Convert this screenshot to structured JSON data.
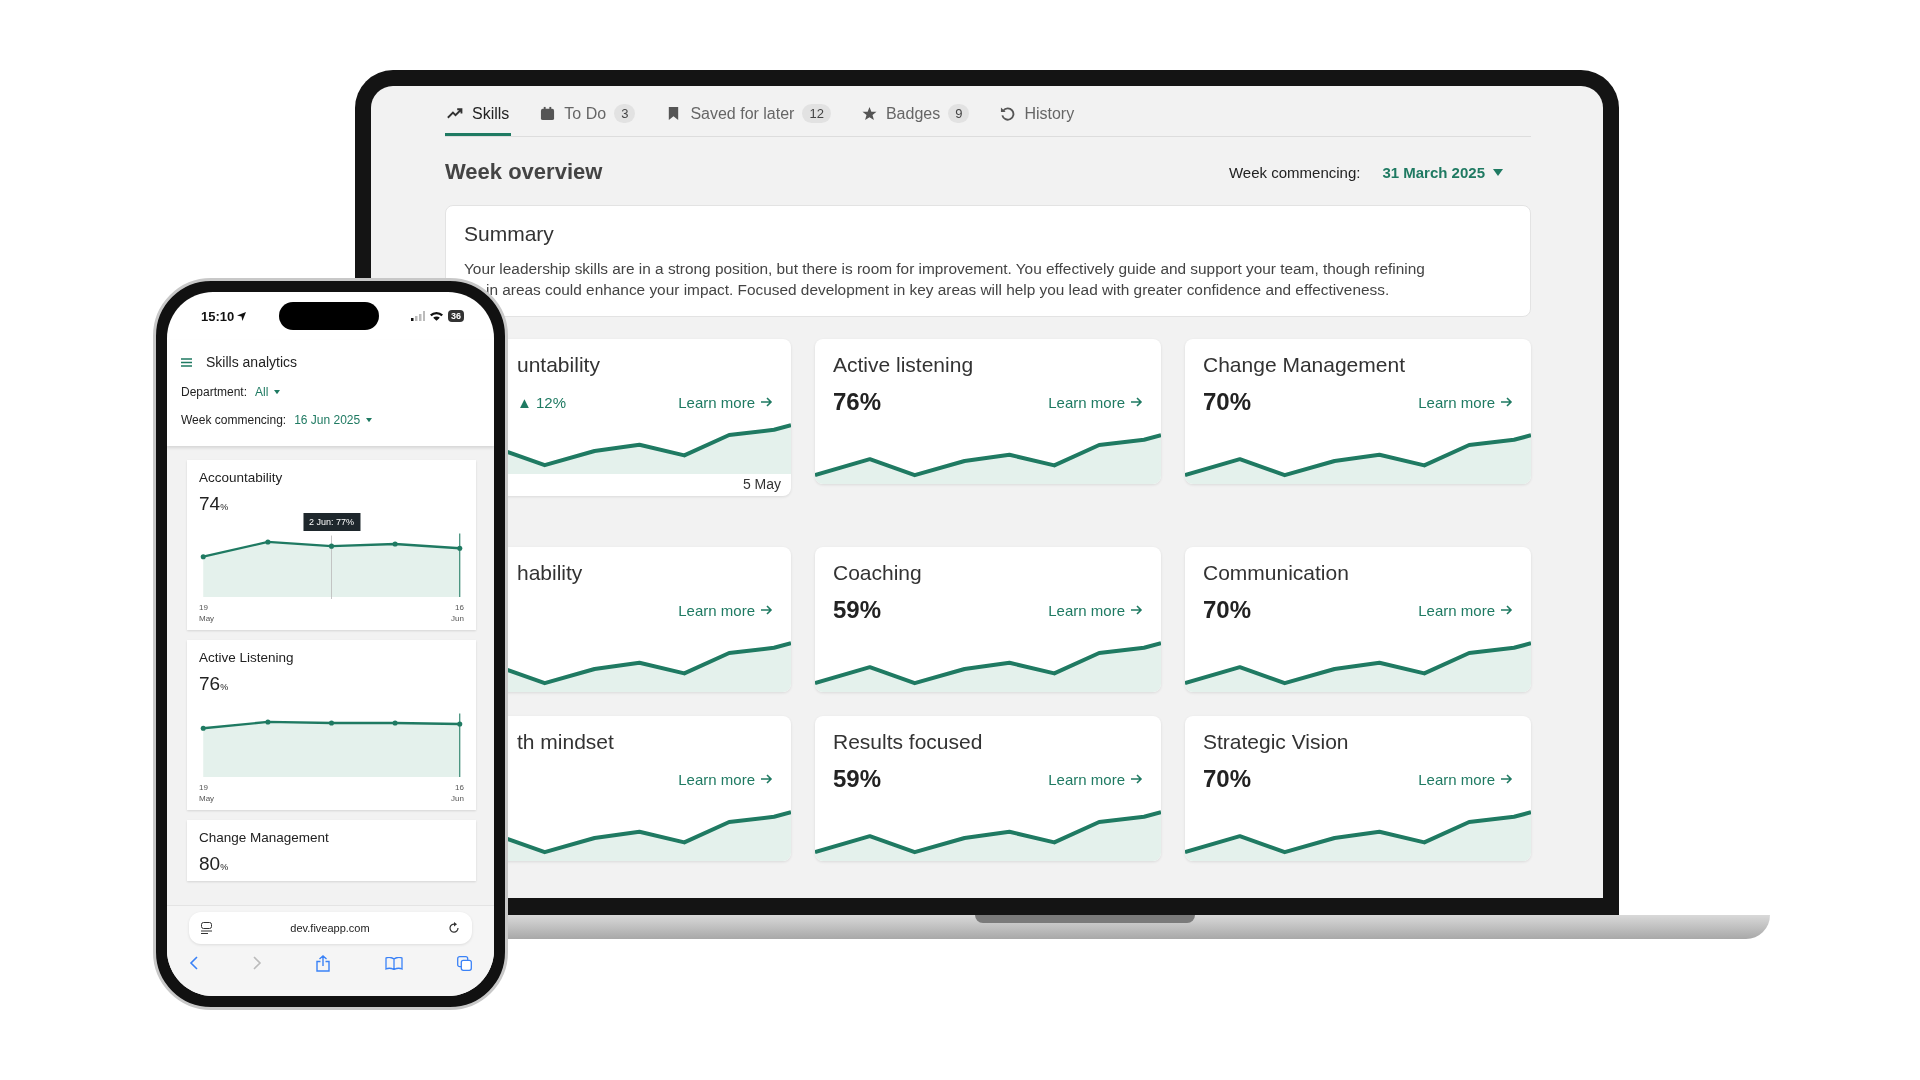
{
  "laptop": {
    "tabs": [
      {
        "label": "Skills",
        "kind": "trend",
        "selected": true
      },
      {
        "label": "To Do",
        "kind": "calendar",
        "count": "3",
        "selected": false
      },
      {
        "label": "Saved for later",
        "kind": "bookmark",
        "count": "12",
        "selected": false
      },
      {
        "label": "Badges",
        "kind": "star",
        "count": "9",
        "selected": false
      },
      {
        "label": "History",
        "kind": "history",
        "selected": false
      }
    ],
    "heading": "Week overview",
    "week_label": "Week commencing:",
    "week_value": "31 March 2025",
    "summary": {
      "title": "Summary",
      "lines": [
        "Your leadership skills are in a strong position, but there is room for improvement. You effectively guide and support your team, though refining",
        "in areas could enhance your impact. Focused development in key areas will help you lead with greater confidence and effectiveness."
      ]
    },
    "cards": [
      {
        "title": "untability",
        "delta": "▲ 12%",
        "link": "Learn more",
        "date": "5 May"
      },
      {
        "title": "Active listening",
        "percent": "76%",
        "link": "Learn more"
      },
      {
        "title": "Change Management",
        "percent": "70%",
        "link": "Learn more"
      },
      {
        "title": "hability",
        "link": "Learn more"
      },
      {
        "title": "Coaching",
        "percent": "59%",
        "link": "Learn more"
      },
      {
        "title": "Communication",
        "percent": "70%",
        "link": "Learn more"
      },
      {
        "title": "th mindset",
        "link": "Learn more"
      },
      {
        "title": "Results focused",
        "percent": "59%",
        "link": "Learn more"
      },
      {
        "title": "Strategic Vision",
        "percent": "70%",
        "link": "Learn more"
      }
    ]
  },
  "phone": {
    "time": "15:10",
    "battery": "36",
    "title": "Skills analytics",
    "filters": [
      {
        "label": "Department:",
        "value": "All"
      },
      {
        "label": "Week commencing:",
        "value": "16 Jun 2025"
      }
    ],
    "cards": [
      {
        "title": "Accountability",
        "value": "74",
        "unit": "%",
        "tooltip": "2 Jun: 77%",
        "axis_start": "19 May",
        "axis_end": "16 Jun"
      },
      {
        "title": "Active Listening",
        "value": "76",
        "unit": "%",
        "axis_start": "19 May",
        "axis_end": "16 Jun"
      },
      {
        "title": "Change Management",
        "value": "80",
        "unit": "%"
      }
    ],
    "url": "dev.fiveapp.com"
  }
}
